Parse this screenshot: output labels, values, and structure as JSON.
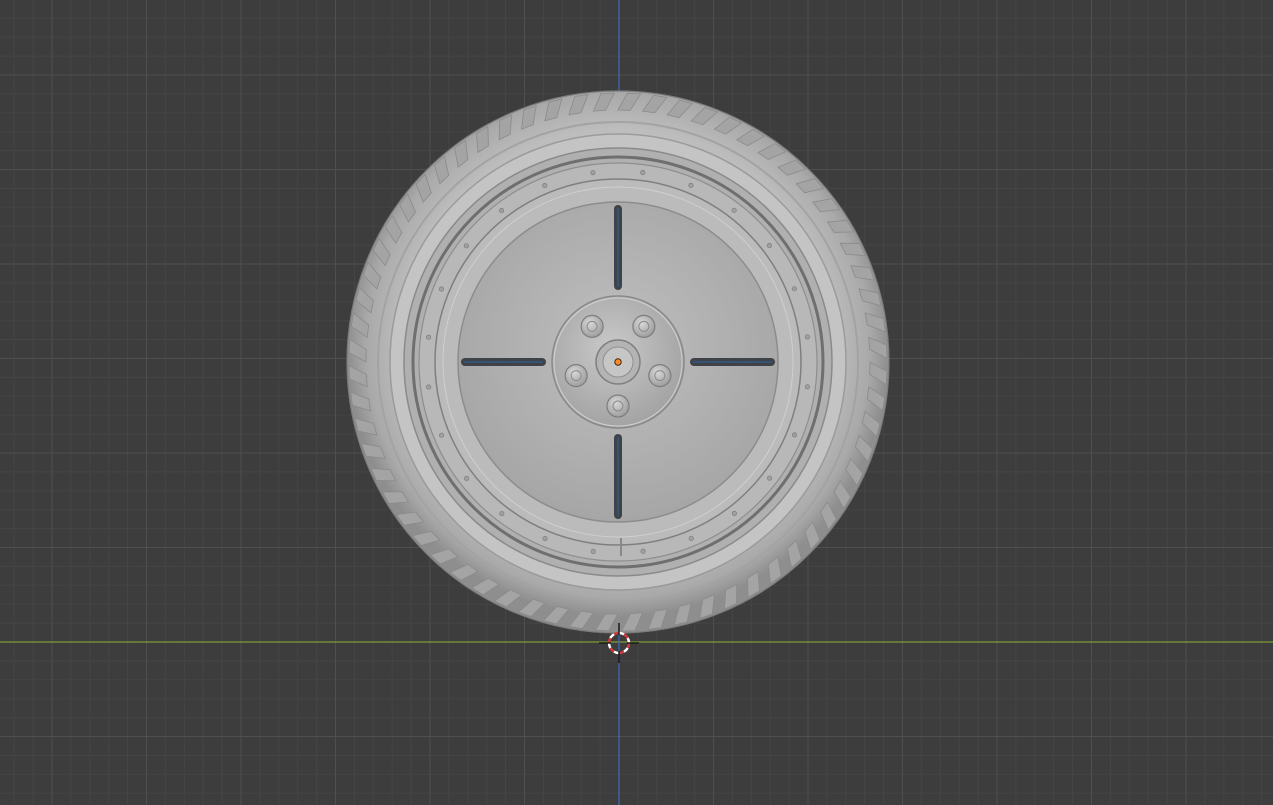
{
  "viewport": {
    "view": "front-orthographic",
    "background_color": "#3d3d3d",
    "grid_minor_color": "#454545",
    "grid_major_color": "#4f4f4f",
    "x_axis_color": "#7d9c34",
    "z_axis_color": "#3f6cb8",
    "grid_visible": true
  },
  "object": {
    "kind": "wheel-with-tire",
    "shading": "solid-gray",
    "material_color": "#b6b6b6",
    "selected": false,
    "spoke_slot_count": 4,
    "lug_nut_count": 5,
    "origin_color": "#ff8a2a"
  },
  "cursor_3d": {
    "visible": true,
    "colors": [
      "#d23b3b",
      "#ffffff"
    ]
  },
  "icons": [
    "3d-cursor-icon",
    "object-origin-icon"
  ]
}
